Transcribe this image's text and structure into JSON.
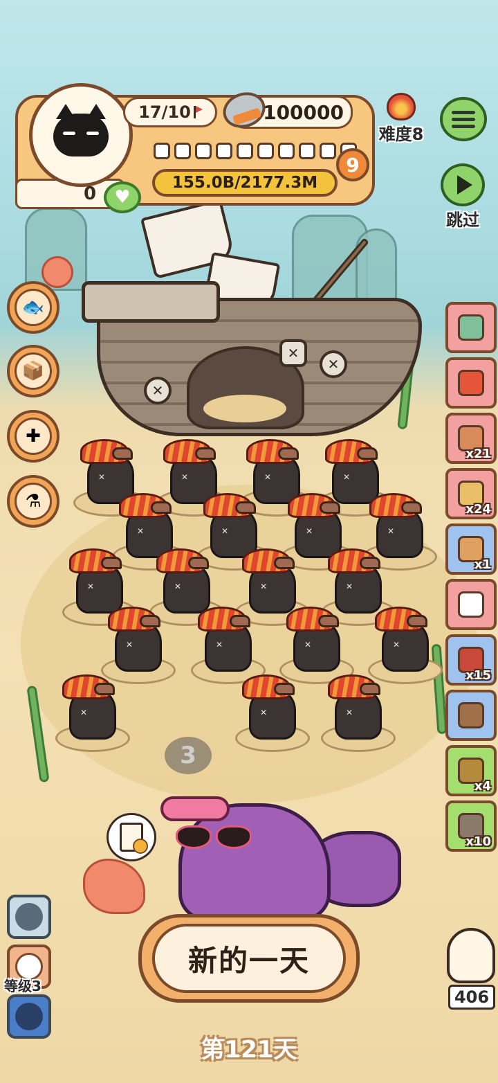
{
  "hud": {
    "progress_count": "17/10",
    "coins": "100000",
    "difficulty_label": "难度8",
    "level": "9",
    "capacity": "155.0B/2177.3M",
    "hearts_value": "0",
    "slot_count": 10
  },
  "top_right": {
    "skip_label": "跳过"
  },
  "left_buttons": [
    "fish-mascot",
    "cardboard-box",
    "first-aid-kit",
    "potion-bottle"
  ],
  "right_items": [
    {
      "icon": "bell-icon",
      "count": "",
      "color": "red"
    },
    {
      "icon": "feather-icon",
      "count": "",
      "color": "red"
    },
    {
      "icon": "bird-cage-icon",
      "count": "x21",
      "color": "red"
    },
    {
      "icon": "egg-cushion-icon",
      "count": "x24",
      "color": "red"
    },
    {
      "icon": "bread-icon",
      "count": "x1",
      "color": "blue"
    },
    {
      "icon": "jar-icon",
      "count": "",
      "color": "red"
    },
    {
      "icon": "meat-plate-icon",
      "count": "x15",
      "color": "blue"
    },
    {
      "icon": "crate-icon",
      "count": "",
      "color": "blue"
    },
    {
      "icon": "seeds-icon",
      "count": "x4",
      "color": "green"
    },
    {
      "icon": "dig-spot-icon",
      "count": "x10",
      "color": "green"
    }
  ],
  "field": {
    "chick_badge": "3"
  },
  "bottom": {
    "new_day_label": "新的一天",
    "day_label": "第121天",
    "player_level_label": "等级3",
    "seal_count": "406"
  },
  "colors": {
    "hud_panel": "#f7c77f",
    "outline": "#7a4a2a",
    "green_button": "#8fd36a",
    "progress_bar": "#f3c33d",
    "level_badge": "#f08a3b"
  }
}
